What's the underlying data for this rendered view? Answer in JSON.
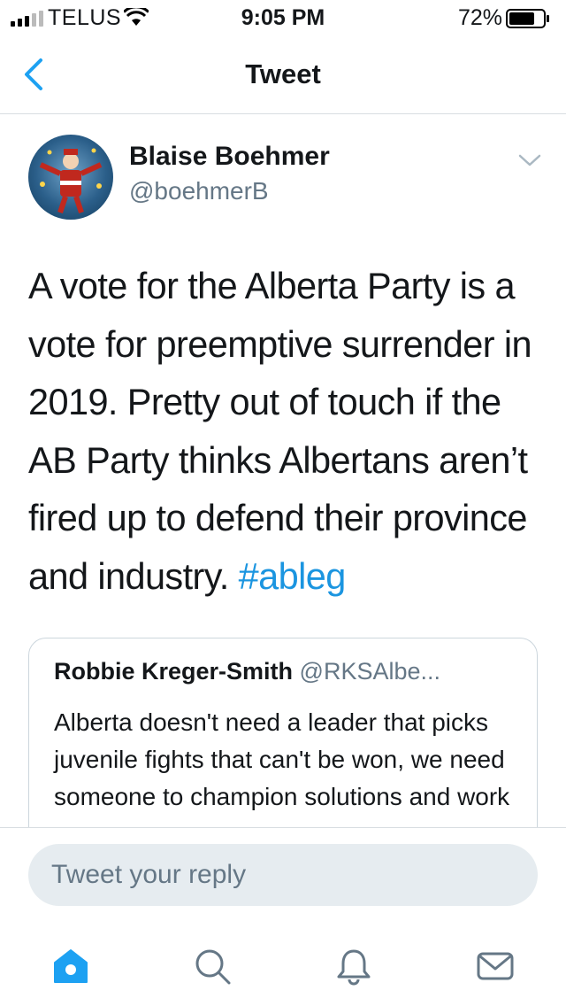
{
  "status_bar": {
    "carrier": "TELUS",
    "time": "9:05 PM",
    "battery": "72%"
  },
  "nav": {
    "title": "Tweet",
    "back_icon": "chevron-left-icon"
  },
  "tweet": {
    "author_name": "Blaise Boehmer",
    "author_handle": "@boehmerB",
    "text": "A vote for the Alberta Party is a vote for preemptive surrender in 2019. Pretty out of touch if the AB Party thinks Albertans aren’t fired up to defend their province and industry. ",
    "hashtag": "#ableg",
    "menu_icon": "chevron-down-icon"
  },
  "quoted_tweet": {
    "author_name": "Robbie Kreger-Smith",
    "author_handle": "@RKSAlbe...",
    "text": "Alberta doesn't need a leader that picks juvenile fights that can't be won, we need someone to champion solutions and work"
  },
  "reply": {
    "placeholder": "Tweet your reply"
  },
  "tabs": [
    {
      "icon": "home-icon",
      "active": true
    },
    {
      "icon": "search-icon",
      "active": false
    },
    {
      "icon": "bell-icon",
      "active": false
    },
    {
      "icon": "mail-icon",
      "active": false
    }
  ],
  "colors": {
    "accent": "#1da1f2",
    "hashtag": "#1b95e0",
    "secondary_text": "#657786"
  }
}
